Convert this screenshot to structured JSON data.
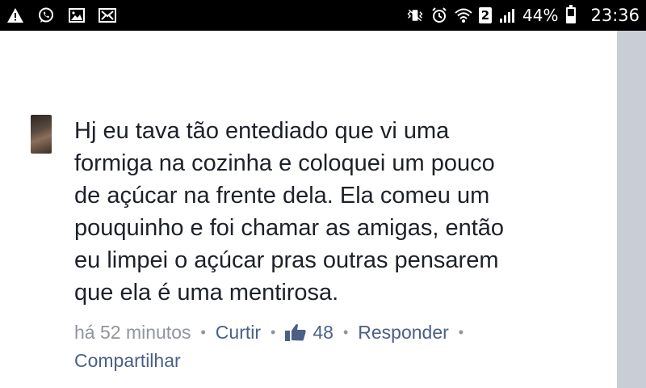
{
  "status_bar": {
    "left_icons": [
      "alert-icon",
      "whatsapp-icon",
      "image-icon",
      "missed-call-icon"
    ],
    "right_icons": [
      "vibrate-icon",
      "alarm-icon",
      "wifi-icon",
      "sim-2-icon",
      "signal-icon",
      "battery-icon"
    ],
    "sim_slot": "2",
    "battery_percent": "44%",
    "time": "23:36"
  },
  "comment": {
    "avatar": "user-avatar",
    "text_lines": [
      "Hj eu tava tão entediado que vi uma",
      "formiga na cozinha e coloquei um pouco",
      "de açúcar na frente dela. Ela comeu um",
      "pouquinho e foi chamar as amigas, então",
      "eu limpei o açúcar pras outras pensarem",
      "que ela é uma mentirosa."
    ],
    "time": "há 52 minutos",
    "separator": "•",
    "like_label": "Curtir",
    "like_count": "48",
    "reply_label": "Responder",
    "share_label": "Compartilhar"
  },
  "colors": {
    "status_bar_bg": "#000000",
    "text": "#1d2129",
    "link": "#4b5f87",
    "muted": "#90949c",
    "side_rail": "#c9cdd6"
  }
}
